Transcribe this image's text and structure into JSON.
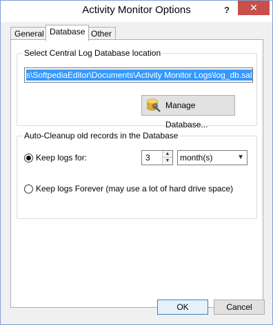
{
  "window": {
    "title": "Activity Monitor Options",
    "help_label": "?",
    "close_label": "✕"
  },
  "tabs": [
    {
      "label": "General",
      "active": false
    },
    {
      "label": "Database",
      "active": true
    },
    {
      "label": "Other",
      "active": false
    }
  ],
  "central_log": {
    "group_title": "Select Central Log Database location",
    "path_value": "s\\SoftpediaEditor\\Documents\\Activity Monitor Logs\\log_db.salog",
    "manage_button_label": "Manage Database...",
    "manage_button_icon": "database-icon"
  },
  "cleanup": {
    "group_title": "Auto-Cleanup old records in the Database",
    "keep_for_label": "Keep logs for:",
    "keep_for_selected": true,
    "keep_value": "3",
    "unit_selected": "month(s)",
    "keep_forever_label": "Keep logs Forever (may use a lot of hard drive space)",
    "keep_forever_selected": false
  },
  "footer": {
    "ok_label": "OK",
    "cancel_label": "Cancel"
  },
  "colors": {
    "selection": "#3399ff",
    "close_button": "#c7504a",
    "window_border": "#7a9fd0"
  }
}
